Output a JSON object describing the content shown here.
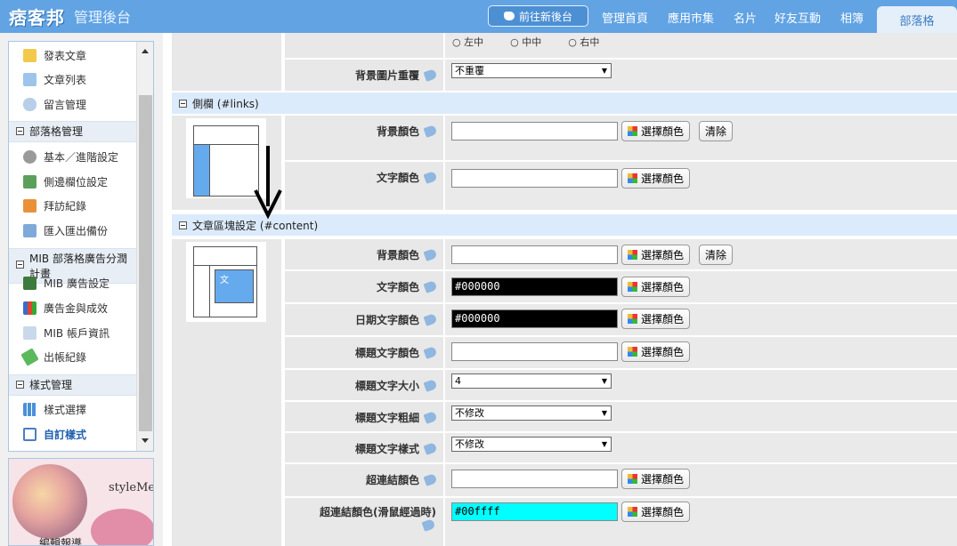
{
  "header": {
    "logo_text": "痞客邦",
    "logo_sub": "管理後台",
    "new_admin_button": "前往新後台",
    "nav": [
      "管理首頁",
      "應用市集",
      "名片",
      "好友互動",
      "相簿"
    ],
    "active_tab": "部落格"
  },
  "sidebar": {
    "items_top": [
      "發表文章",
      "文章列表",
      "留言管理"
    ],
    "sections": [
      {
        "title": "部落格管理",
        "items": [
          "基本／進階設定",
          "側邊欄位設定",
          "拜訪紀錄",
          "匯入匯出備份"
        ]
      },
      {
        "title": "MIB 部落格廣告分潤計畫",
        "items": [
          "MIB 廣告設定",
          "廣告金與成效",
          "MIB 帳戶資訊",
          "出帳紀錄"
        ]
      },
      {
        "title": "樣式管理",
        "items": [
          "樣式選擇",
          "自訂樣式"
        ]
      }
    ],
    "ad": {
      "brand": "styleMe",
      "caption": "編輯報導"
    }
  },
  "main": {
    "top_radios": [
      "左中",
      "中中",
      "右中"
    ],
    "bg_repeat": {
      "label": "背景圖片重覆",
      "value": "不重覆"
    },
    "links_section": {
      "title": "側欄 (#links)",
      "rows": [
        {
          "label": "背景顏色",
          "value": "",
          "button": "選擇顏色",
          "clear": "清除"
        },
        {
          "label": "文字顏色",
          "value": "",
          "button": "選擇顏色"
        }
      ]
    },
    "content_section": {
      "title": "文章區塊設定 (#content)",
      "preview_text": "文",
      "rows": [
        {
          "label": "背景顏色",
          "type": "color",
          "value": "",
          "button": "選擇顏色",
          "clear": "清除"
        },
        {
          "label": "文字顏色",
          "type": "color",
          "value": "#000000",
          "bg": "#000000",
          "fg": "#ffffff",
          "button": "選擇顏色"
        },
        {
          "label": "日期文字顏色",
          "type": "color",
          "value": "#000000",
          "bg": "#000000",
          "fg": "#ffffff",
          "button": "選擇顏色"
        },
        {
          "label": "標題文字顏色",
          "type": "color",
          "value": "",
          "button": "選擇顏色"
        },
        {
          "label": "標題文字大小",
          "type": "select",
          "value": "4"
        },
        {
          "label": "標題文字粗細",
          "type": "select",
          "value": "不修改"
        },
        {
          "label": "標題文字樣式",
          "type": "select",
          "value": "不修改"
        },
        {
          "label": "超連結顏色",
          "type": "color",
          "value": "",
          "button": "選擇顏色"
        },
        {
          "label": "超連結顏色(滑鼠經過時)",
          "type": "color",
          "value": "#00ffff",
          "bg": "#00ffff",
          "fg": "#000000",
          "button": "選擇顏色"
        }
      ]
    }
  },
  "colors": {
    "header_bg": "#61a3e3",
    "section_bg": "#dcebfb",
    "preview_fill": "#66aaee"
  }
}
